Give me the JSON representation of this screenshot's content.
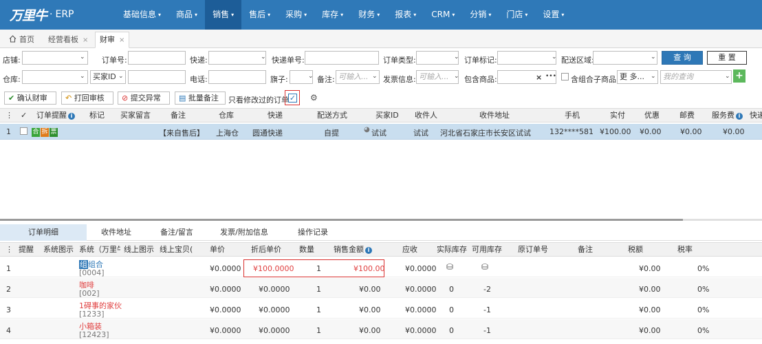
{
  "logo": {
    "brand": "万里牛",
    "dot": "·",
    "suffix": "ERP"
  },
  "nav": [
    {
      "label": "基础信息",
      "caret": "▾"
    },
    {
      "label": "商品",
      "caret": "▾"
    },
    {
      "label": "销售",
      "caret": "▾",
      "active": true
    },
    {
      "label": "售后",
      "caret": "▾"
    },
    {
      "label": "采购",
      "caret": "▾"
    },
    {
      "label": "库存",
      "caret": "▾"
    },
    {
      "label": "财务",
      "caret": "▾"
    },
    {
      "label": "报表",
      "caret": "▾"
    },
    {
      "label": "CRM",
      "caret": "▾"
    },
    {
      "label": "分销",
      "caret": "▾"
    },
    {
      "label": "门店",
      "caret": "▾"
    },
    {
      "label": "设置",
      "caret": "▾"
    }
  ],
  "tabs": [
    {
      "label": "首页"
    },
    {
      "label": "经营看板",
      "close": "×"
    },
    {
      "label": "财审",
      "close": "×"
    }
  ],
  "filters": {
    "shop": "店铺:",
    "order_no": "订单号:",
    "express": "快递:",
    "express_no": "快递单号:",
    "order_type": "订单类型:",
    "order_mark": "订单标记:",
    "region": "配送区域:",
    "warehouse": "仓库:",
    "buyer_select": "买家ID",
    "phone": "电话:",
    "flag": "旗子:",
    "remark": "备注:",
    "remark_ph": "可输入...",
    "invoice": "发票信息:",
    "invoice_ph": "可输入...",
    "contains": "包含商品:",
    "contains_x": "×",
    "contains_more": "•••",
    "combo": "含组合子商品",
    "more": "更 多...",
    "my_query": "我的查询",
    "query_btn": "查 询",
    "reset_btn": "重 置",
    "plus": "+"
  },
  "actions": {
    "confirm": "确认财审",
    "print": "打回审核",
    "submit": "提交异常",
    "batch": "批量备注",
    "only_modified": "只看修改过的订单"
  },
  "icons": {
    "confirm": "✔",
    "print": "↶",
    "submit": "⊘",
    "batch": "▤",
    "gear": "⚙",
    "check": "✓"
  },
  "order_table": {
    "columns": [
      "⋮",
      "✓",
      "订单提醒",
      "标记",
      "买家留言",
      "备注",
      "仓库",
      "快递",
      "配送方式",
      "买家ID",
      "收件人",
      "收件地址",
      "手机",
      "实付",
      "优惠",
      "邮费",
      "服务费",
      "快递"
    ],
    "row": {
      "index": "1",
      "tags": [
        "合",
        "拆",
        "票"
      ],
      "remark": "【来自售后】",
      "warehouse": "上海仓",
      "express": "圆通快递",
      "delivery": "自提",
      "buyer": "试试",
      "receiver": "试试",
      "address": "河北省石家庄市长安区试试",
      "phone": "132****581",
      "paid": "¥100.00",
      "discount": "¥0.00",
      "postage": "¥0.00",
      "service": "¥0.00"
    }
  },
  "bottom_tabs": [
    "订单明细",
    "收件地址",
    "备注/留言",
    "发票/附加信息",
    "操作记录"
  ],
  "detail_table": {
    "columns": [
      "⋮",
      "提醒",
      "系统图示",
      "系统（万里牛",
      "线上图示",
      "线上宝贝(",
      "单价",
      "折后单价",
      "数量",
      "销售金额",
      "应收",
      "实际库存",
      "可用库存",
      "原订单号",
      "备注",
      "税额",
      "税率"
    ],
    "rows": [
      {
        "idx": "1",
        "badge": "组",
        "name": "组合",
        "code": "[0004]",
        "price": "¥0.0000",
        "disc": "¥100.0000",
        "qty": "1",
        "amount": "¥100.00",
        "recv": "¥0.0000",
        "stock": "⛁",
        "avail": "⛁",
        "tax": "¥0.00",
        "rate": "0%"
      },
      {
        "idx": "2",
        "badge": "",
        "name": "咖啡",
        "code": "[002]",
        "price": "¥0.0000",
        "disc": "¥0.0000",
        "qty": "1",
        "amount": "¥0.00",
        "recv": "¥0.0000",
        "stock": "0",
        "avail": "-2",
        "tax": "¥0.00",
        "rate": "0%"
      },
      {
        "idx": "3",
        "badge": "",
        "name": "1碍事的家伙",
        "code": "[1233]",
        "price": "¥0.0000",
        "disc": "¥0.0000",
        "qty": "1",
        "amount": "¥0.00",
        "recv": "¥0.0000",
        "stock": "0",
        "avail": "-1",
        "tax": "¥0.00",
        "rate": "0%"
      },
      {
        "idx": "4",
        "badge": "",
        "name": "小箱装",
        "code": "[12423]",
        "price": "¥0.0000",
        "disc": "¥0.0000",
        "qty": "1",
        "amount": "¥0.00",
        "recv": "¥0.0000",
        "stock": "0",
        "avail": "-1",
        "tax": "¥0.00",
        "rate": "0%"
      }
    ]
  }
}
